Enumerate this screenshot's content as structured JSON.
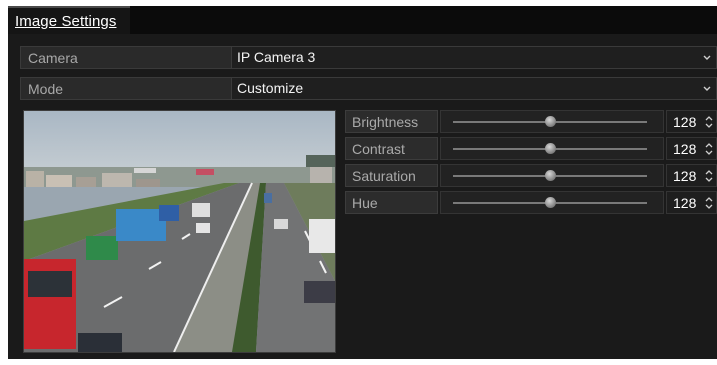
{
  "window": {
    "tab_title": "Image Settings"
  },
  "form": {
    "camera": {
      "label": "Camera",
      "value": "IP Camera 3"
    },
    "mode": {
      "label": "Mode",
      "value": "Customize"
    }
  },
  "adjustments": [
    {
      "label": "Brightness",
      "value": "128",
      "level": 0.5
    },
    {
      "label": "Contrast",
      "value": "128",
      "level": 0.5
    },
    {
      "label": "Saturation",
      "value": "128",
      "level": 0.5
    },
    {
      "label": "Hue",
      "value": "128",
      "level": 0.5
    }
  ],
  "icons": {
    "dropdown": "chevron-down-icon",
    "spinner": "up-down-spinner-icon"
  },
  "colors": {
    "background": "#1a1a1a",
    "row_label_bg": "#2a2a2a",
    "text_primary": "#f4f4f4",
    "text_label": "#a8a8a8"
  }
}
